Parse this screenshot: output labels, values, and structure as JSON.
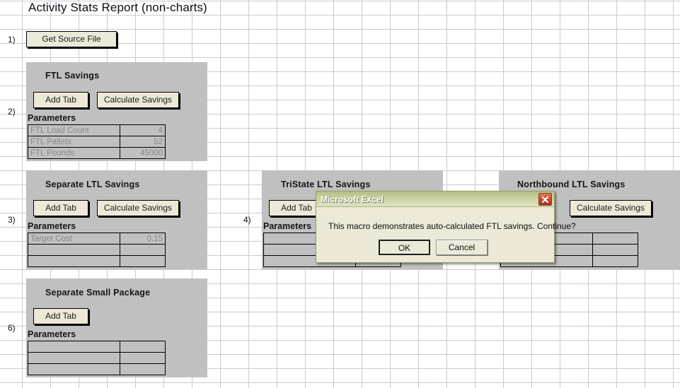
{
  "report": {
    "title": "Activity Stats Report (non-charts)"
  },
  "steps": {
    "s1": "1)",
    "s2": "2)",
    "s3": "3)",
    "s4": "4)",
    "s6": "6)"
  },
  "labels": {
    "parameters": "Parameters",
    "add_tab": "Add Tab",
    "calculate_savings": "Calculate Savings",
    "get_source_file": "Get Source File"
  },
  "panels": [
    {
      "id": "ftl-savings",
      "title": "FTL Savings",
      "buttons": [
        "Add Tab",
        "Calculate Savings"
      ],
      "parameters_label": "Parameters",
      "rows": [
        {
          "key": "FTL Load Count",
          "value": "4"
        },
        {
          "key": "FTL Pallets",
          "value": "52"
        },
        {
          "key": "FTL Pounds",
          "value": "45000"
        }
      ]
    },
    {
      "id": "separate-ltl-savings",
      "title": "Separate LTL Savings",
      "buttons": [
        "Add Tab",
        "Calculate Savings"
      ],
      "parameters_label": "Parameters",
      "rows": [
        {
          "key": "Target Cost",
          "value": "0.15"
        },
        {
          "key": "",
          "value": ""
        },
        {
          "key": "",
          "value": ""
        }
      ]
    },
    {
      "id": "tristate-ltl-savings",
      "title": "TriState LTL Savings",
      "buttons": [
        "Add Tab"
      ],
      "parameters_label": "Parameters",
      "rows": [
        {
          "key": "",
          "value": ""
        },
        {
          "key": "",
          "value": ""
        },
        {
          "key": "",
          "value": ""
        }
      ]
    },
    {
      "id": "northbound-ltl-savings",
      "title": "Northbound LTL Savings",
      "buttons": [
        "Calculate Savings"
      ],
      "parameters_label": "",
      "rows": [
        {
          "key": "",
          "value": ""
        },
        {
          "key": "",
          "value": ""
        },
        {
          "key": "",
          "value": ""
        }
      ]
    },
    {
      "id": "separate-small-package",
      "title": "Separate Small Package",
      "buttons": [
        "Add Tab"
      ],
      "parameters_label": "Parameters",
      "rows": [
        {
          "key": "",
          "value": ""
        },
        {
          "key": "",
          "value": ""
        },
        {
          "key": "",
          "value": ""
        }
      ]
    }
  ],
  "dialog": {
    "title": "Microsoft Excel",
    "message": "This macro demonstrates auto-calculated FTL savings. Continue?",
    "ok_label": "OK",
    "cancel_label": "Cancel",
    "close_icon": "close-icon"
  },
  "colors": {
    "panel_background": "#c0c0c0",
    "button_face": "#ece9d8",
    "grid_line": "#c6cbd4",
    "dialog_title_bar": "#b5bd84",
    "close_button": "#c9472c"
  }
}
